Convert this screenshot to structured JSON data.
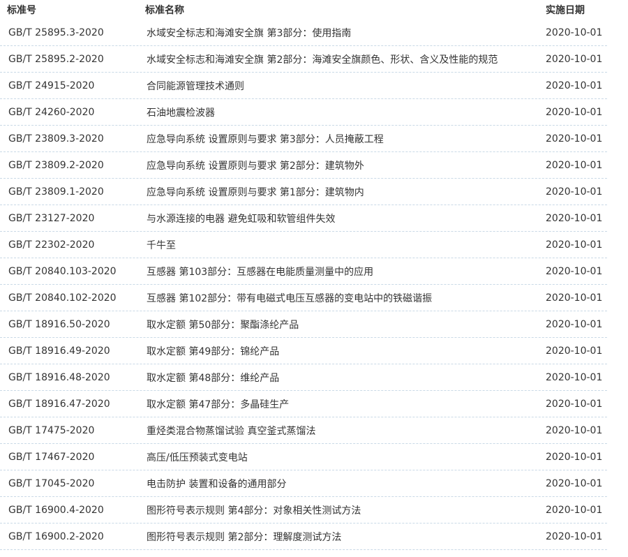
{
  "table": {
    "headers": {
      "number": "标准号",
      "name": "标准名称",
      "date": "实施日期"
    },
    "rows": [
      {
        "number": "GB/T 25895.3-2020",
        "name": "水域安全标志和海滩安全旗 第3部分：使用指南",
        "date": "2020-10-01"
      },
      {
        "number": "GB/T 25895.2-2020",
        "name": "水域安全标志和海滩安全旗 第2部分：海滩安全旗颜色、形状、含义及性能的规范",
        "date": "2020-10-01"
      },
      {
        "number": "GB/T 24915-2020",
        "name": "合同能源管理技术通则",
        "date": "2020-10-01"
      },
      {
        "number": "GB/T 24260-2020",
        "name": "石油地震检波器",
        "date": "2020-10-01"
      },
      {
        "number": "GB/T 23809.3-2020",
        "name": "应急导向系统 设置原则与要求 第3部分：人员掩蔽工程",
        "date": "2020-10-01"
      },
      {
        "number": "GB/T 23809.2-2020",
        "name": "应急导向系统 设置原则与要求 第2部分：建筑物外",
        "date": "2020-10-01"
      },
      {
        "number": "GB/T 23809.1-2020",
        "name": "应急导向系统 设置原则与要求 第1部分：建筑物内",
        "date": "2020-10-01"
      },
      {
        "number": "GB/T 23127-2020",
        "name": "与水源连接的电器 避免虹吸和软管组件失效",
        "date": "2020-10-01"
      },
      {
        "number": "GB/T 22302-2020",
        "name": "千牛至",
        "date": "2020-10-01"
      },
      {
        "number": "GB/T 20840.103-2020",
        "name": "互感器 第103部分：互感器在电能质量测量中的应用",
        "date": "2020-10-01"
      },
      {
        "number": "GB/T 20840.102-2020",
        "name": "互感器 第102部分：带有电磁式电压互感器的变电站中的铁磁谐振",
        "date": "2020-10-01"
      },
      {
        "number": "GB/T 18916.50-2020",
        "name": "取水定额 第50部分：聚酯涤纶产品",
        "date": "2020-10-01"
      },
      {
        "number": "GB/T 18916.49-2020",
        "name": "取水定额 第49部分：锦纶产品",
        "date": "2020-10-01"
      },
      {
        "number": "GB/T 18916.48-2020",
        "name": "取水定额 第48部分：维纶产品",
        "date": "2020-10-01"
      },
      {
        "number": "GB/T 18916.47-2020",
        "name": "取水定额 第47部分：多晶硅生产",
        "date": "2020-10-01"
      },
      {
        "number": "GB/T 17475-2020",
        "name": "重烃类混合物蒸馏试验 真空釜式蒸馏法",
        "date": "2020-10-01"
      },
      {
        "number": "GB/T 17467-2020",
        "name": "高压/低压预装式变电站",
        "date": "2020-10-01"
      },
      {
        "number": "GB/T 17045-2020",
        "name": "电击防护 装置和设备的通用部分",
        "date": "2020-10-01"
      },
      {
        "number": "GB/T 16900.4-2020",
        "name": "图形符号表示规则 第4部分：对象相关性测试方法",
        "date": "2020-10-01"
      },
      {
        "number": "GB/T 16900.2-2020",
        "name": "图形符号表示规则 第2部分：理解度测试方法",
        "date": "2020-10-01"
      }
    ]
  }
}
